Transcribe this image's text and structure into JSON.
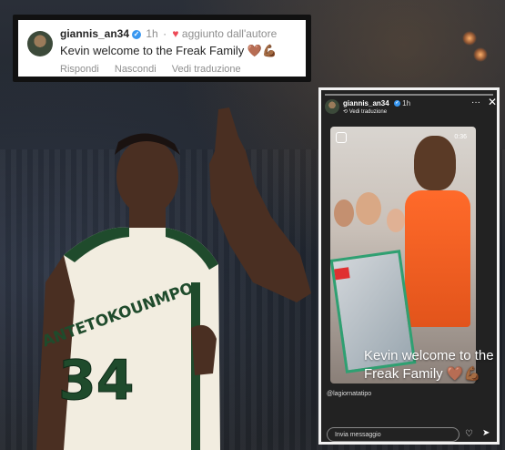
{
  "comment": {
    "username": "giannis_an34",
    "verified_icon": "verified-badge-icon",
    "time": "1h",
    "liked_label": "aggiunto dall'autore",
    "text": "Kevin welcome to the Freak Family",
    "emoji": "🤎💪🏾",
    "actions": {
      "reply": "Rispondi",
      "hide": "Nascondi",
      "translate": "Vedi traduzione"
    },
    "accent": "#ed4956"
  },
  "jersey": {
    "name": "ANTETOKOUNMPO",
    "number": "34",
    "primary_color": "#f2ede0",
    "accent_color": "#1f4b2c"
  },
  "story": {
    "username": "giannis_an34",
    "time": "1h",
    "translate": "Vedi traduzione",
    "timer": "0:36",
    "caption_line1": "Kevin welcome to the",
    "caption_line2": "Freak Family",
    "caption_emoji": "🤎💪🏾",
    "tag": "@lagiornatatipo",
    "input_placeholder": "Invia messaggio"
  }
}
